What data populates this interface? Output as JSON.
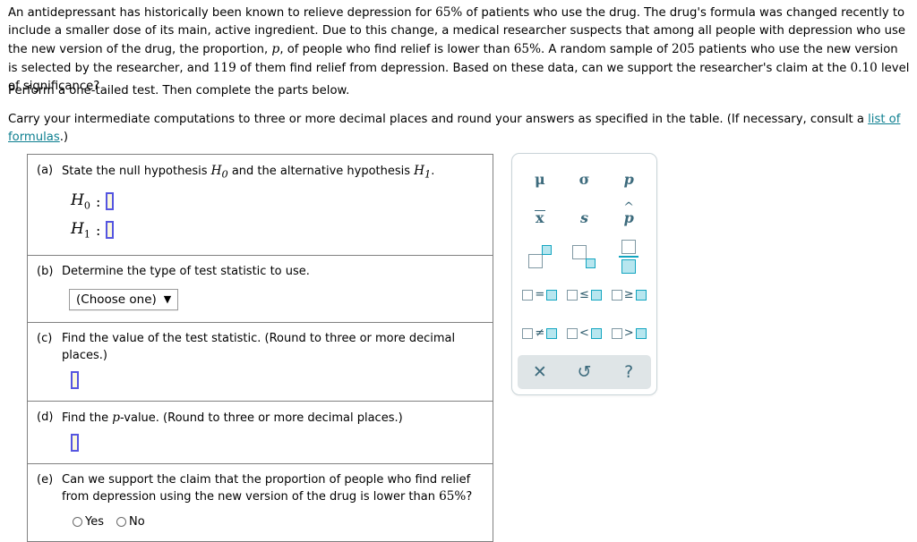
{
  "problem": {
    "paragraph_parts": [
      "An antidepressant has historically been known to relieve depression for ",
      "65%",
      " of patients who use the drug. The drug's formula was changed recently to include a smaller dose of its main, active ingredient. Due to this change, a medical researcher suspects that among all people with depression who use the new version of the drug, the proportion, ",
      "p",
      ", of people who find relief is lower than ",
      "65%",
      ". A random sample of ",
      "205",
      " patients who use the new version is selected by the researcher, and ",
      "119",
      " of them find relief from depression. Based on these data, can we support the researcher's claim at the ",
      "0.10",
      " level of significance?"
    ],
    "instruction": "Perform a one-tailed test. Then complete the parts below.",
    "rounding_note_pre": "Carry your intermediate computations to three or more decimal places and round your answers as specified in the table. (If necessary, consult a ",
    "rounding_link": "list of formulas",
    "rounding_note_post": ".)"
  },
  "answer_card": {
    "part_a": {
      "label": "(a)",
      "text_1": "State the null hypothesis ",
      "h0": "H",
      "h0_sub": "0",
      "text_2": " and the alternative hypothesis ",
      "h1": "H",
      "h1_sub": "1",
      "text_3": ".",
      "row_h0_name": "H",
      "row_h0_sub": "0",
      "row_h1_name": "H",
      "row_h1_sub": "1",
      "colon": ":"
    },
    "part_b": {
      "label": "(b)",
      "text": "Determine the type of test statistic to use.",
      "select_value": "(Choose one)",
      "caret": "▼"
    },
    "part_c": {
      "label": "(c)",
      "text": "Find the value of the test statistic. (Round to three or more decimal places.)"
    },
    "part_d": {
      "label": "(d)",
      "text_1": "Find the ",
      "text_p": "p",
      "text_2": "-value. (Round to three or more decimal places.)"
    },
    "part_e": {
      "label": "(e)",
      "text_1": "Can we support the claim that the proportion of people who find relief from depression using the new version of the drug is lower than ",
      "text_pct": "65%",
      "text_2": "?",
      "options": [
        {
          "label": "Yes"
        },
        {
          "label": "No"
        }
      ]
    }
  },
  "symbol_palette": {
    "rows": [
      [
        {
          "name": "mu-symbol",
          "glyph": "μ"
        },
        {
          "name": "sigma-symbol",
          "glyph": "σ"
        },
        {
          "name": "p-symbol",
          "glyph": "p"
        }
      ],
      [
        {
          "name": "x-bar-symbol",
          "glyph": "x"
        },
        {
          "name": "s-symbol",
          "glyph": "s"
        },
        {
          "name": "p-hat-symbol",
          "glyph": "p"
        }
      ]
    ],
    "operators": [
      {
        "name": "equals-box",
        "op": "="
      },
      {
        "name": "less-equal-box",
        "op": "≤"
      },
      {
        "name": "greater-equal-box",
        "op": "≥"
      },
      {
        "name": "not-equal-box",
        "op": "≠"
      },
      {
        "name": "less-than-box",
        "op": "<"
      },
      {
        "name": "greater-than-box",
        "op": ">"
      }
    ],
    "toolbar": [
      {
        "name": "clear-button",
        "glyph": "✕"
      },
      {
        "name": "undo-button",
        "glyph": "↺"
      },
      {
        "name": "help-button",
        "glyph": "?"
      }
    ]
  },
  "colors": {
    "link": "#0d7f90",
    "palette_text": "#3d6b7d",
    "box_outline": "#7f98a3",
    "box_fill": "#b7e6ef",
    "box_fill_border": "#13a5c0",
    "input_border": "#5555e0",
    "input_fill": "#fbf8dd",
    "card_border": "#808080",
    "toolbar_bg": "#dfe5e7"
  }
}
